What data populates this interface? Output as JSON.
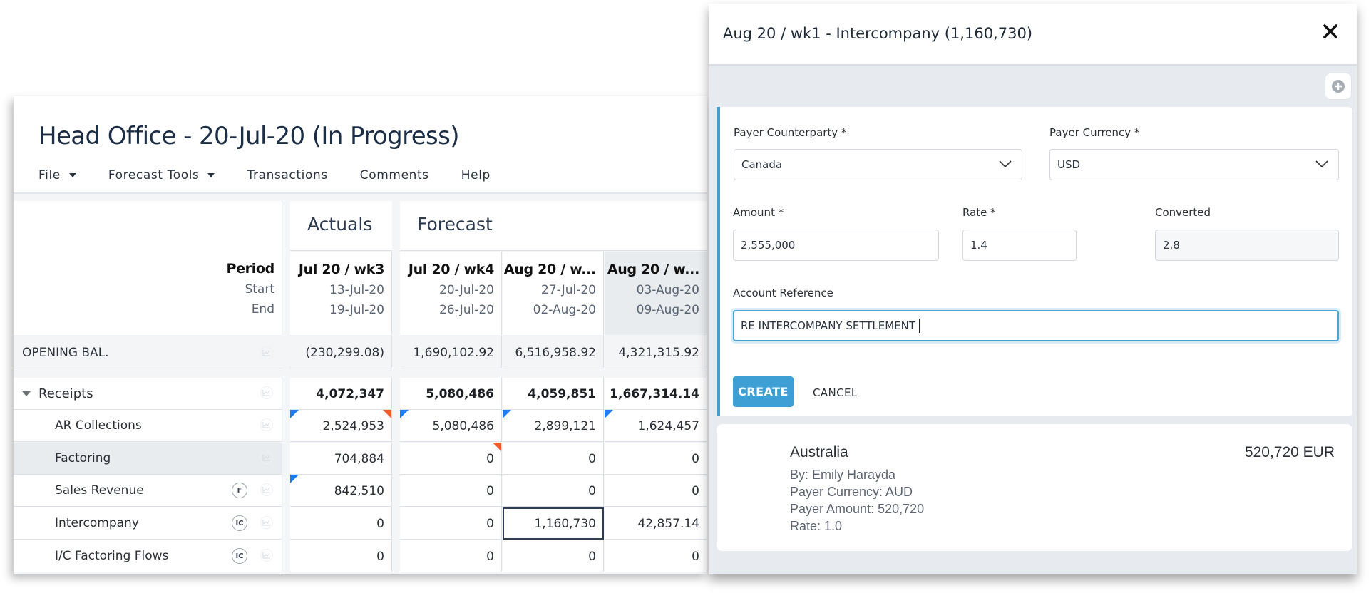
{
  "main": {
    "title": "Head Office - 20-Jul-20 (In Progress)",
    "menu": [
      {
        "label": "File",
        "has_dropdown": true
      },
      {
        "label": "Forecast Tools",
        "has_dropdown": true
      },
      {
        "label": "Transactions",
        "has_dropdown": false
      },
      {
        "label": "Comments",
        "has_dropdown": false
      },
      {
        "label": "Help",
        "has_dropdown": false
      }
    ],
    "grid": {
      "period_header": {
        "period": "Period",
        "start": "Start",
        "end": "End"
      },
      "groups": {
        "actuals": "Actuals",
        "forecast": "Forecast"
      },
      "columns": [
        {
          "name": "Jul 20 / wk3",
          "start": "13-Jul-20",
          "end": "19-Jul-20",
          "group": "Actuals"
        },
        {
          "name": "Jul 20 / wk4",
          "start": "20-Jul-20",
          "end": "26-Jul-20",
          "group": "Forecast"
        },
        {
          "name": "Aug 20 / w...",
          "start": "27-Jul-20",
          "end": "02-Aug-20",
          "group": "Forecast"
        },
        {
          "name": "Aug 20 / w...",
          "start": "03-Aug-20",
          "end": "09-Aug-20",
          "group": "Forecast",
          "highlighted": true
        }
      ],
      "opening_balance": {
        "label": "OPENING BAL.",
        "values": [
          "(230,299.08)",
          "1,690,102.92",
          "6,516,958.92",
          "4,321,315.92"
        ]
      },
      "rows": [
        {
          "label": "Receipts",
          "level": 0,
          "expanded": true,
          "bold": true,
          "badge": "",
          "values": [
            "4,072,347",
            "5,080,486",
            "4,059,851",
            "1,667,314.14"
          ],
          "flags_blue": [
            false,
            false,
            false,
            false
          ],
          "flags_orange": [
            false,
            false,
            false,
            false
          ]
        },
        {
          "label": "AR Collections",
          "level": 1,
          "badge": "",
          "values": [
            "2,524,953",
            "5,080,486",
            "2,899,121",
            "1,624,457"
          ],
          "flags_blue": [
            true,
            true,
            true,
            true
          ],
          "flags_orange": [
            true,
            false,
            false,
            false
          ]
        },
        {
          "label": "Factoring",
          "level": 1,
          "badge": "",
          "hovered": true,
          "values": [
            "704,884",
            "0",
            "0",
            "0"
          ],
          "flags_blue": [
            false,
            false,
            false,
            false
          ],
          "flags_orange": [
            false,
            true,
            false,
            false
          ]
        },
        {
          "label": "Sales Revenue",
          "level": 1,
          "badge": "F",
          "values": [
            "842,510",
            "0",
            "0",
            "0"
          ],
          "flags_blue": [
            true,
            false,
            false,
            false
          ],
          "flags_orange": [
            false,
            false,
            false,
            false
          ]
        },
        {
          "label": "Intercompany",
          "level": 1,
          "badge": "IC",
          "values": [
            "0",
            "0",
            "1,160,730",
            "42,857.14"
          ],
          "selected_col": 2,
          "flags_blue": [
            false,
            false,
            false,
            false
          ],
          "flags_orange": [
            false,
            false,
            false,
            false
          ]
        },
        {
          "label": "I/C Factoring Flows",
          "level": 1,
          "badge": "IC",
          "values": [
            "0",
            "0",
            "0",
            "0"
          ],
          "flags_blue": [
            false,
            false,
            false,
            false
          ],
          "flags_orange": [
            false,
            false,
            false,
            false
          ]
        }
      ]
    }
  },
  "panel": {
    "title": "Aug 20 / wk1 - Intercompany (1,160,730)",
    "close_icon": "close-icon",
    "add_icon": "plus-circle-icon",
    "form": {
      "payer_counterparty": {
        "label": "Payer Counterparty  *",
        "value": "Canada"
      },
      "payer_currency": {
        "label": "Payer Currency  *",
        "value": "USD"
      },
      "amount": {
        "label": "Amount  *",
        "value": "2,555,000"
      },
      "rate": {
        "label": "Rate  *",
        "value": "1.4"
      },
      "converted": {
        "label": "Converted",
        "value": "2.8"
      },
      "account_reference": {
        "label": "Account Reference",
        "value": "RE INTERCOMPANY SETTLEMENT"
      },
      "create_label": "CREATE",
      "cancel_label": "CANCEL"
    },
    "entries": [
      {
        "name": "Australia",
        "amount": "520,720 EUR",
        "by": "By: Emily Harayda",
        "payer_currency": "Payer Currency: AUD",
        "payer_amount": "Payer Amount: 520,720",
        "rate": "Rate: 1.0"
      }
    ]
  },
  "colors": {
    "accent": "#3d9fd3",
    "flag_blue": "#1e7cf0",
    "flag_orange": "#f25a28",
    "title_text": "#1c2e45"
  }
}
